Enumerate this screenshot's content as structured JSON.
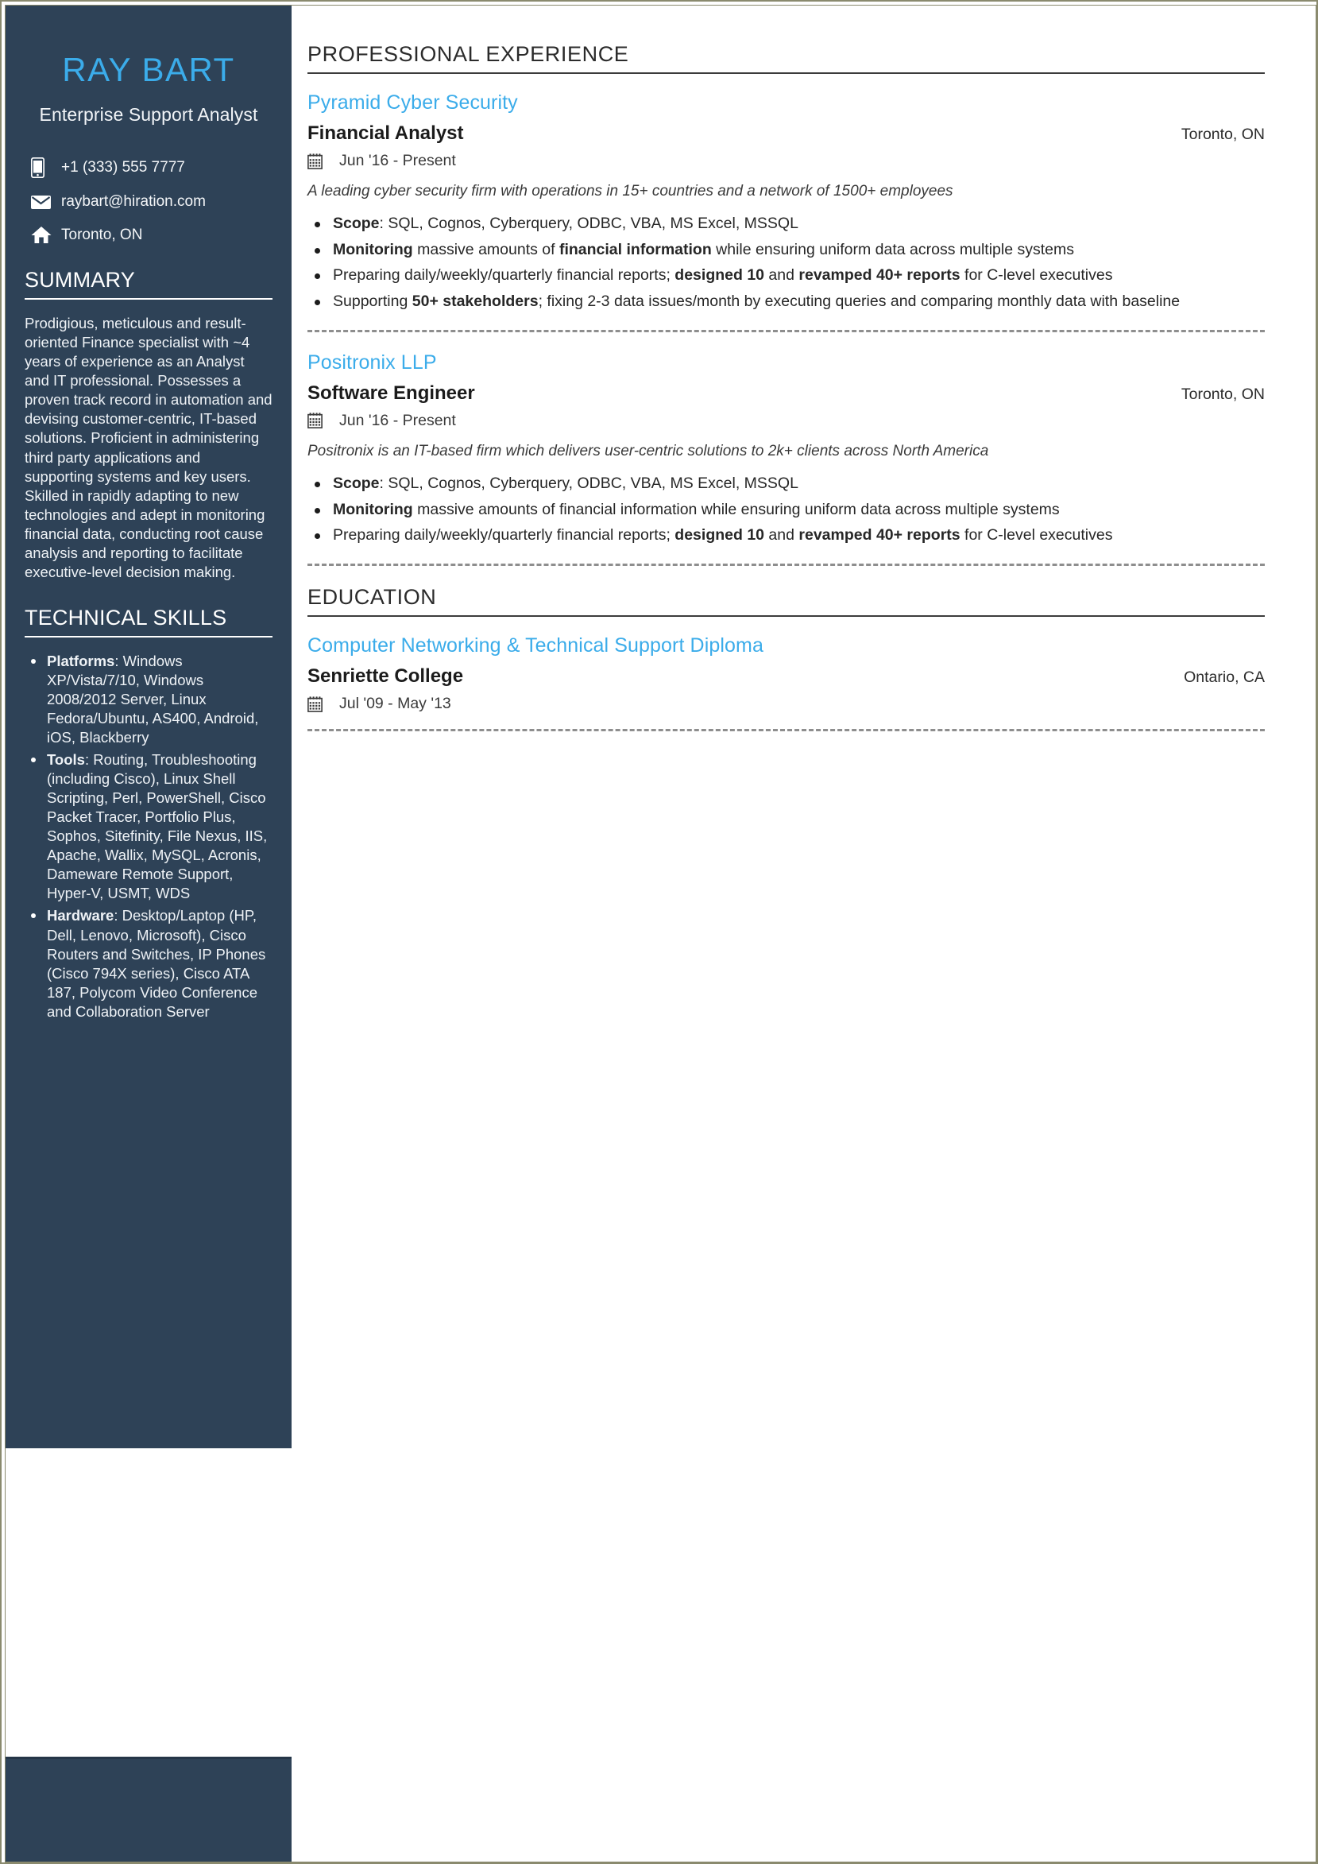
{
  "theme": {
    "sidebar_bg": "#2e4257",
    "accent_blue": "#3bacea",
    "page_border": "#8a8a6e",
    "text_dark": "#272727"
  },
  "sidebar": {
    "name": "RAY BART",
    "headline": "Enterprise Support Analyst",
    "contact": [
      {
        "icon": "phone-icon",
        "value": "+1 (333) 555 7777"
      },
      {
        "icon": "email-icon",
        "value": "raybart@hiration.com"
      },
      {
        "icon": "home-icon",
        "value": "Toronto, ON"
      }
    ],
    "summary": {
      "title": "SUMMARY",
      "text": "Prodigious, meticulous and result-oriented Finance specialist with ~4 years of experience as an Analyst and IT professional. Possesses a proven track record in automation and devising customer-centric, IT-based solutions. Proficient in administering third party applications and supporting systems and key users. Skilled in rapidly adapting to new technologies and adept in monitoring financial data, conducting root cause analysis and reporting to facilitate executive-level decision making."
    },
    "skills": {
      "title": "TECHNICAL SKILLS",
      "items": [
        {
          "label": "Platforms",
          "value": ": Windows XP/Vista/7/10, Windows 2008/2012 Server, Linux Fedora/Ubuntu, AS400, Android, iOS, Blackberry"
        },
        {
          "label": "Tools",
          "value": ": Routing, Troubleshooting (including Cisco), Linux Shell Scripting, Perl, PowerShell, Cisco Packet Tracer, Portfolio Plus, Sophos, Sitefinity, File Nexus, IIS, Apache, Wallix, MySQL, Acronis, Dameware Remote Support, Hyper-V, USMT, WDS"
        },
        {
          "label": "Hardware",
          "value": ": Desktop/Laptop (HP, Dell, Lenovo, Microsoft), Cisco Routers and Switches, IP Phones (Cisco 794X series), Cisco ATA 187, Polycom Video Conference and Collaboration Server"
        }
      ]
    }
  },
  "main": {
    "experience": {
      "title": "PROFESSIONAL EXPERIENCE",
      "jobs": [
        {
          "org": "Pyramid Cyber Security",
          "role": "Financial Analyst",
          "location": "Toronto, ON",
          "dates": "Jun '16 -  Present",
          "blurb": "A leading cyber security firm with operations in 15+ countries and a network of 1500+ employees",
          "bullets": [
            [
              {
                "t": "Scope",
                "b": true
              },
              {
                "t": ": SQL, Cognos, Cyberquery, ODBC, VBA, MS Excel, MSSQL",
                "b": false
              }
            ],
            [
              {
                "t": "Monitoring",
                "b": true
              },
              {
                "t": " massive amounts of ",
                "b": false
              },
              {
                "t": "financial information",
                "b": true
              },
              {
                "t": " while ensuring uniform data across multiple systems",
                "b": false
              }
            ],
            [
              {
                "t": "Preparing daily/weekly/quarterly financial reports; ",
                "b": false
              },
              {
                "t": "designed 10",
                "b": true
              },
              {
                "t": " and ",
                "b": false
              },
              {
                "t": "revamped 40+ reports",
                "b": true
              },
              {
                "t": " for C-level executives",
                "b": false
              }
            ],
            [
              {
                "t": "Supporting ",
                "b": false
              },
              {
                "t": "50+ stakeholders",
                "b": true
              },
              {
                "t": "; fixing 2-3 data issues/month by executing queries and comparing monthly data with baseline",
                "b": false
              }
            ]
          ]
        },
        {
          "org": "Positronix LLP",
          "role": "Software Engineer",
          "location": "Toronto, ON",
          "dates": "Jun '16 -  Present",
          "blurb": "Positronix is an IT-based firm which delivers user-centric solutions to 2k+ clients across North America",
          "blurb_clipped": true,
          "bullets": [
            [
              {
                "t": "Scope",
                "b": true
              },
              {
                "t": ": SQL, Cognos, Cyberquery, ODBC, VBA, MS Excel, MSSQL",
                "b": false
              }
            ],
            [
              {
                "t": "Monitoring",
                "b": true
              },
              {
                "t": " massive amounts of financial information while ensuring uniform data across multiple systems",
                "b": false
              }
            ],
            [
              {
                "t": "Preparing daily/weekly/quarterly financial reports; ",
                "b": false
              },
              {
                "t": "designed 10",
                "b": true
              },
              {
                "t": " and ",
                "b": false
              },
              {
                "t": "revamped 40+ reports",
                "b": true
              },
              {
                "t": " for C-level executives",
                "b": false
              }
            ]
          ]
        }
      ]
    },
    "education": {
      "title": "EDUCATION",
      "entries": [
        {
          "degree": "Computer Networking & Technical Support Diploma",
          "school": "Senriette College",
          "location": "Ontario, CA",
          "dates": "Jul '09 -  May '13"
        }
      ]
    }
  }
}
